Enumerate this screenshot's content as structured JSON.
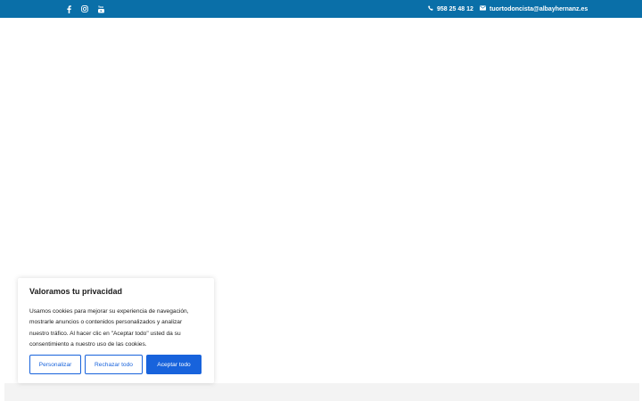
{
  "topbar": {
    "social_icons": [
      "facebook-icon",
      "instagram-icon",
      "youtube-icon"
    ],
    "phone": "958 25 48 12",
    "email": "tuortodoncista@albayhernanz.es",
    "background_color": "#0a6fa8"
  },
  "cookie_banner": {
    "title": "Valoramos tu privacidad",
    "text_line_1": "Usamos cookies para mejorar su experiencia de navegación,",
    "text_line_2": "mostrarle anuncios o contenidos personalizados y analizar",
    "text_line_3": "nuestro tráfico. Al hacer clic en \"Aceptar todo\" usted da su",
    "text_line_4": "consentimiento a nuestro uso de las cookies.",
    "customize_label": "Personalizar",
    "reject_label": "Rechazar todo",
    "accept_label": "Aceptar todo",
    "accent_color": "#1863dc"
  }
}
